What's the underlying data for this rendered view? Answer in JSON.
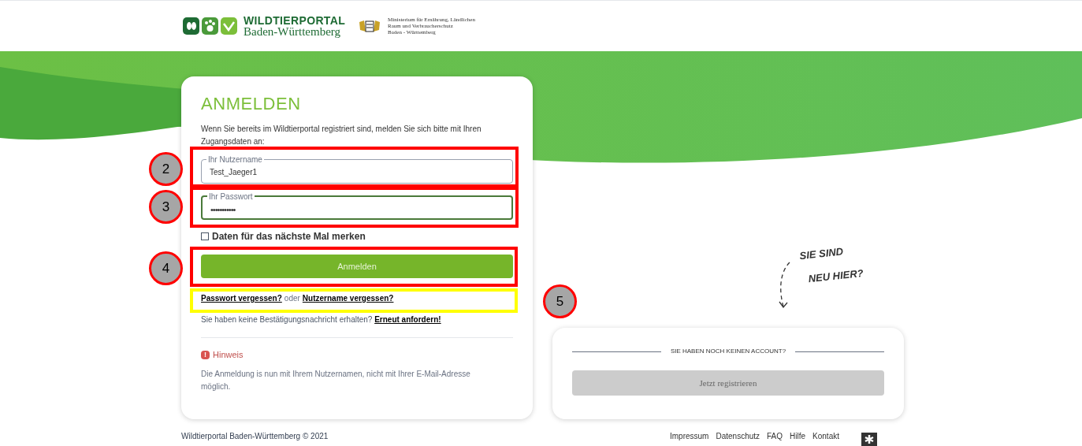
{
  "header": {
    "logo_title": "WILDTIERPORTAL",
    "logo_subtitle": "Baden-Württemberg",
    "ministry": [
      "Ministerium für Ernährung, Ländlichen",
      "Raum und Verbraucherschutz",
      "Baden - Württemberg"
    ]
  },
  "login": {
    "title": "ANMELDEN",
    "intro": "Wenn Sie bereits im Wildtierportal registriert sind, melden Sie sich bitte mit Ihren Zugangsdaten an:",
    "fields": [
      {
        "kind": "text",
        "label": "Ihr Nutzername",
        "value": "Test_Jaeger1",
        "focused": false
      },
      {
        "kind": "password",
        "label": "Ihr Passwort",
        "value": "•••••••••••",
        "focused": true
      }
    ],
    "remember": {
      "label": "Daten für das nächste Mal merken",
      "checked": false
    },
    "submit": "Anmelden",
    "forgot": {
      "password_link": "Passwort vergessen?",
      "joiner": "oder",
      "username_link": "Nutzername vergessen?"
    },
    "resend": {
      "text": "Sie haben keine Bestätigungsnachricht erhalten?",
      "link": "Erneut anfordern!"
    },
    "notice": {
      "icon": "!",
      "title": "Hinweis",
      "text": "Die Anmeldung is nun mit Ihrem Nutzernamen, nicht mit Ihrer E-Mail-Adresse möglich."
    }
  },
  "register": {
    "prompt": [
      "SIE SIND",
      "NEU HIER?"
    ],
    "heading": "SIE HABEN NOCH KEINEN ACCOUNT?",
    "button": "Jetzt registrieren",
    "button_disabled": true
  },
  "footer": {
    "copyright": "Wildtierportal Baden-Württemberg © 2021",
    "links": [
      "Impressum",
      "Datenschutz",
      "FAQ",
      "Hilfe",
      "Kontakt"
    ]
  },
  "annotations": {
    "boxes": [
      {
        "color": "#ff0000"
      },
      {
        "color": "#ff0000"
      },
      {
        "color": "#ff0000"
      },
      {
        "color": "#ffff00"
      }
    ],
    "markers": [
      {
        "label": "2"
      },
      {
        "label": "3"
      },
      {
        "label": "4"
      },
      {
        "label": "5"
      }
    ]
  }
}
